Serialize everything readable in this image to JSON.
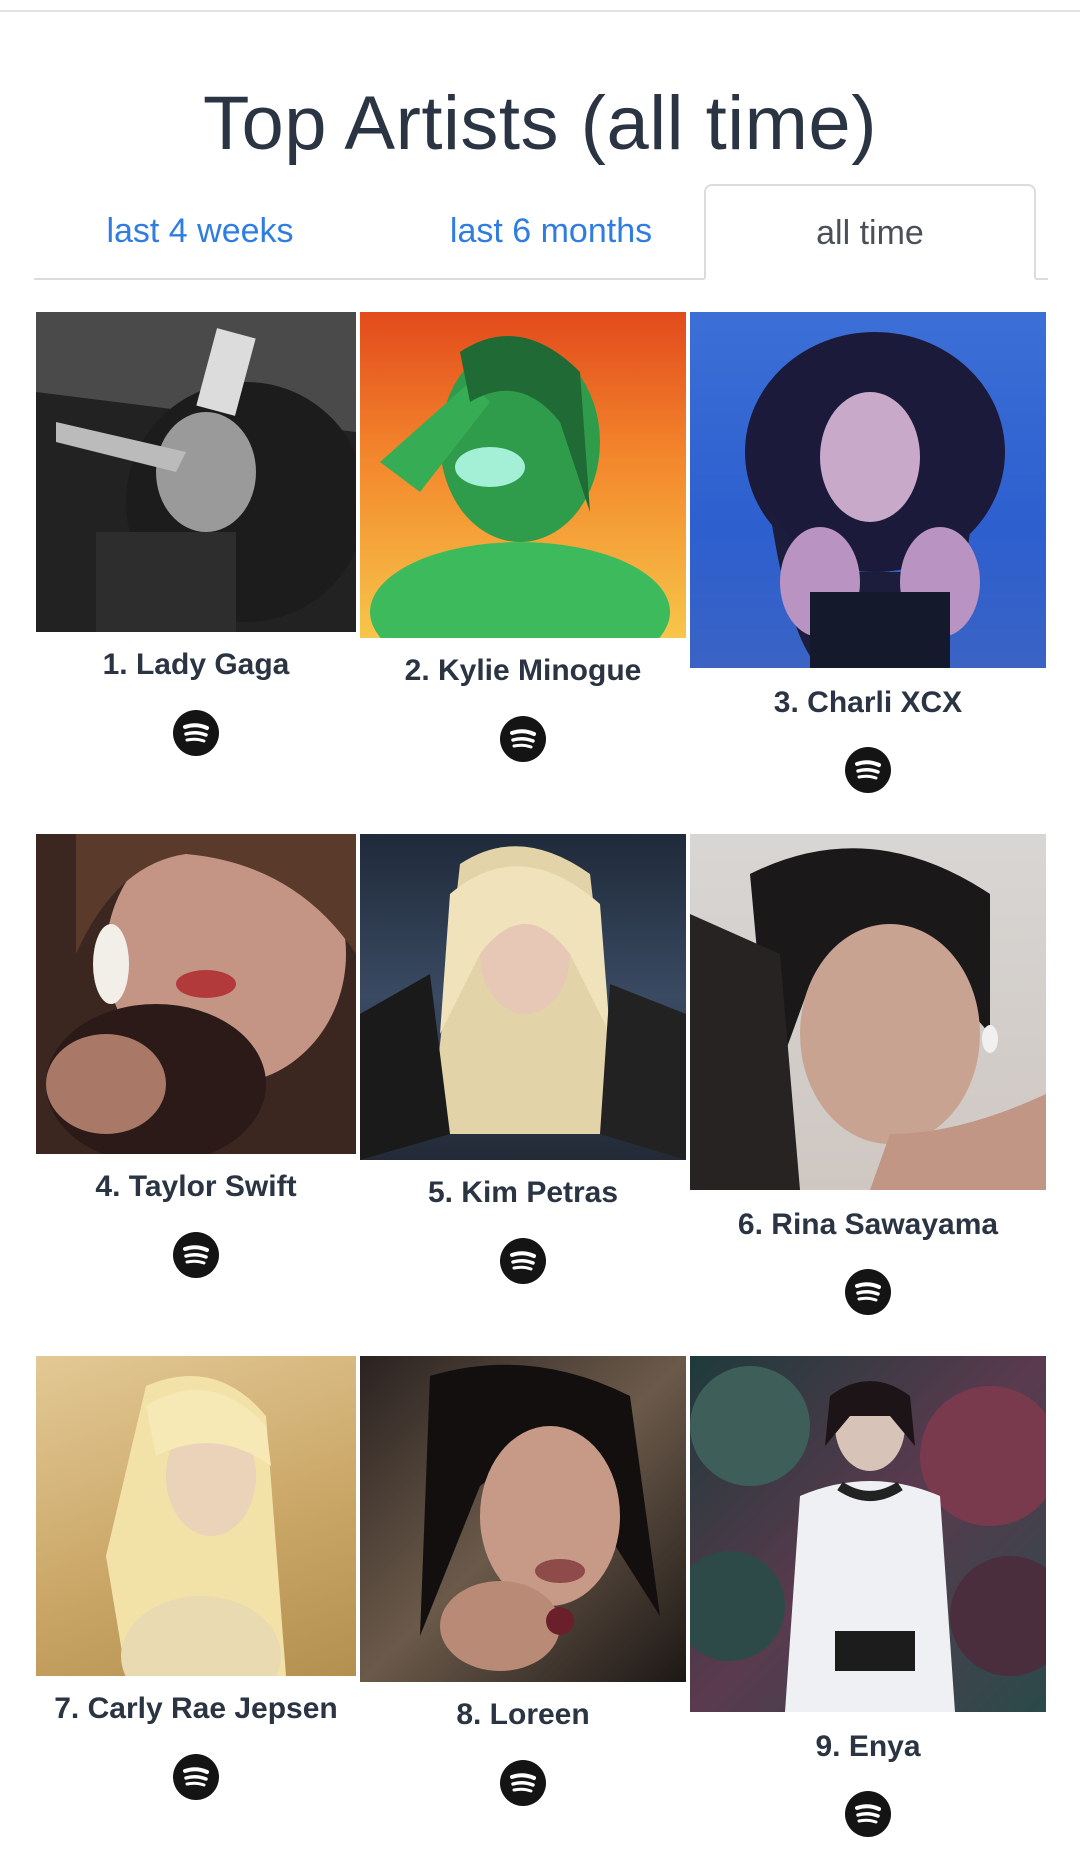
{
  "page": {
    "title": "Top Artists (all time)"
  },
  "tabs": [
    {
      "label": "last 4 weeks",
      "active": false
    },
    {
      "label": "last 6 months",
      "active": false
    },
    {
      "label": "all time",
      "active": true
    }
  ],
  "artists": [
    {
      "name": "1. Lady Gaga",
      "icon": "spotify-icon"
    },
    {
      "name": "2. Kylie Minogue",
      "icon": "spotify-icon"
    },
    {
      "name": "3. Charli XCX",
      "icon": "spotify-icon"
    },
    {
      "name": "4. Taylor Swift",
      "icon": "spotify-icon"
    },
    {
      "name": "5. Kim Petras",
      "icon": "spotify-icon"
    },
    {
      "name": "6. Rina Sawayama",
      "icon": "spotify-icon"
    },
    {
      "name": "7. Carly Rae Jepsen",
      "icon": "spotify-icon"
    },
    {
      "name": "8. Loreen",
      "icon": "spotify-icon"
    },
    {
      "name": "9. Enya",
      "icon": "spotify-icon"
    }
  ],
  "colors": {
    "link": "#2f7de1",
    "title_text": "#2b3443",
    "spotify_icon_bg": "#141414"
  }
}
